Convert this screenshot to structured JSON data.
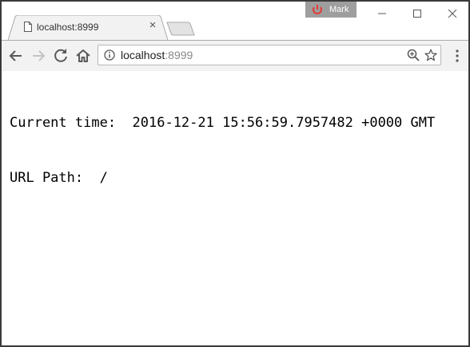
{
  "window": {
    "profile_name": "Mark"
  },
  "tab": {
    "title": "localhost:8999",
    "close_glyph": "×"
  },
  "omnibox": {
    "host": "localhost",
    "port": ":8999"
  },
  "page": {
    "line1": "Current time:  2016-12-21 15:56:59.7957482 +0000 GMT",
    "line2": "URL Path:  /"
  },
  "icons": {
    "back": "arrow-back-icon",
    "forward": "arrow-forward-icon",
    "reload": "reload-icon",
    "home": "home-icon",
    "info": "info-icon",
    "zoom": "zoom-icon",
    "bookmark": "star-icon",
    "menu": "menu-icon"
  },
  "colors": {
    "toolbar_bg": "#f2f2f2",
    "profile_bg": "#9e9e9e",
    "profile_icon": "#e53935",
    "forward_disabled": "#c4c4c4",
    "icon": "#5a5a5a"
  }
}
